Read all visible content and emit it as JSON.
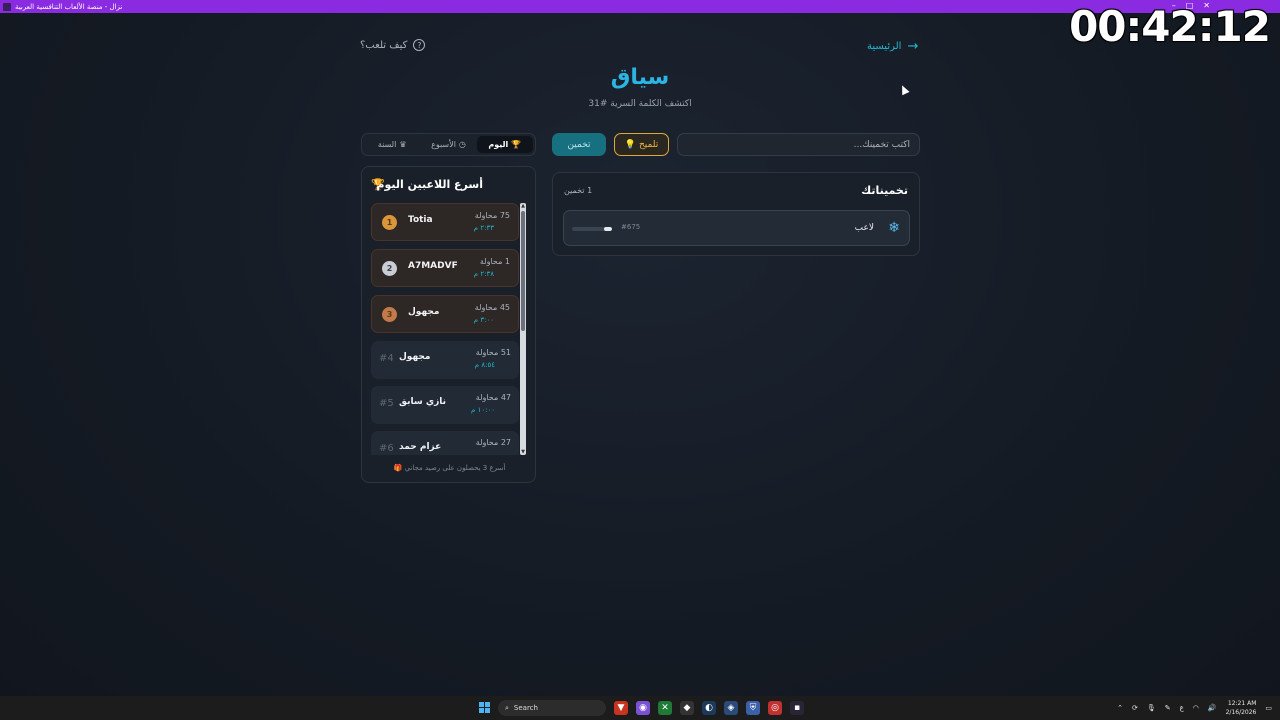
{
  "window": {
    "title": "نزال - منصة الألعاب التنافسية العربية"
  },
  "timer": "00:42:12",
  "nav": {
    "home_label": "الرئيسية",
    "help_label": "كيف تلعب؟"
  },
  "header": {
    "title": "سياق",
    "subtitle": "اكتشف الكلمة السرية #31"
  },
  "input": {
    "placeholder": "اكتب تخمينك..."
  },
  "buttons": {
    "hint": "تلميح",
    "guess": "تخمين"
  },
  "period_tabs": [
    {
      "label": "اليوم",
      "active": true
    },
    {
      "label": "الأسبوع",
      "active": false
    },
    {
      "label": "السنة",
      "active": false
    }
  ],
  "leaderboard": {
    "title": "أسرع اللاعبين اليوم",
    "note": "أسرع 3 يحصلون على رصيد مجاني",
    "rows": [
      {
        "rank": "1",
        "name": "Totia",
        "attempts": "75 محاولة",
        "time": "٢:٣٣ م"
      },
      {
        "rank": "2",
        "name": "A7MADVF",
        "attempts": "1 محاولة",
        "time": "٢:٣٨ م"
      },
      {
        "rank": "3",
        "name": "مجهول",
        "attempts": "45 محاولة",
        "time": "٣:٠٠ م"
      },
      {
        "rank": "#4",
        "name": "مجهول",
        "attempts": "51 محاولة",
        "time": "٨:٥٤ م"
      },
      {
        "rank": "#5",
        "name": "نازي سابق",
        "attempts": "47 محاولة",
        "time": "١٠:٠٠ م"
      },
      {
        "rank": "#6",
        "name": "عزام حمد",
        "attempts": "27 محاولة",
        "time": ""
      }
    ]
  },
  "guesses": {
    "title": "تخميناتك",
    "count": "1 تخمين",
    "items": [
      {
        "word": "لاعب",
        "rank": "#675",
        "progress": 0.2
      }
    ]
  },
  "taskbar": {
    "search_label": "Search",
    "time": "12:21 AM",
    "date": "2/16/2026",
    "lang": "ع"
  },
  "colors": {
    "accent": "#22b8cf",
    "title": "#2bb5e3",
    "hint": "#f0b545",
    "titlebar": "#8a2be2"
  }
}
